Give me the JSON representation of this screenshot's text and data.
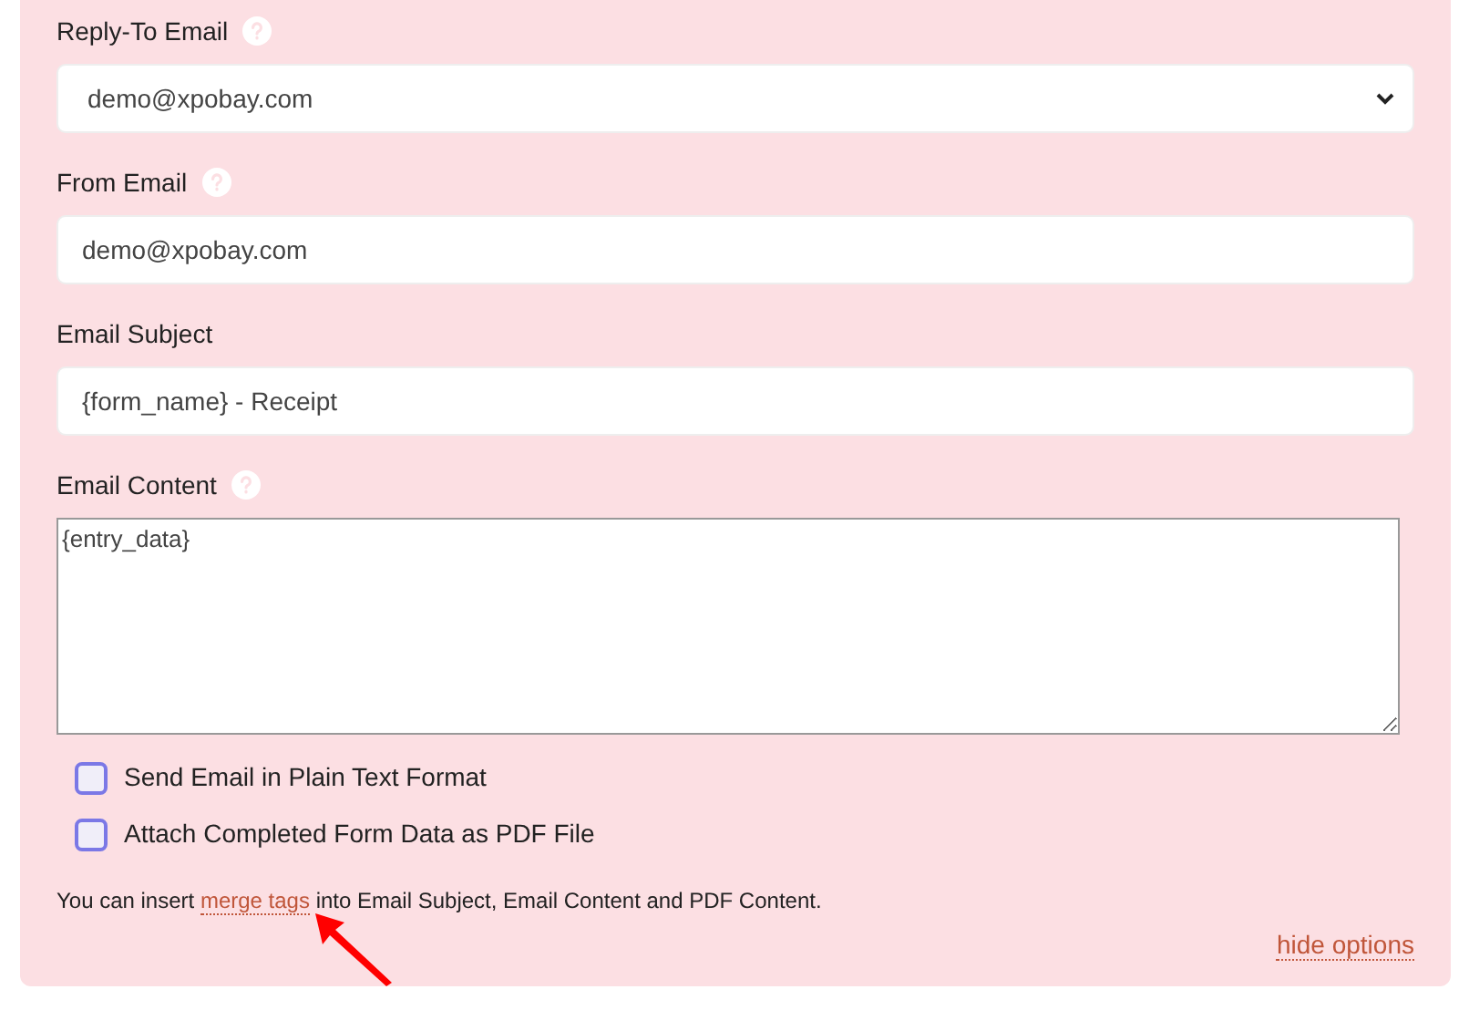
{
  "fields": [
    {
      "kind": "select",
      "label": "Reply-To Email",
      "help": true,
      "value": "demo@xpobay.com"
    },
    {
      "kind": "input",
      "label": "From Email",
      "help": true,
      "value": "demo@xpobay.com"
    },
    {
      "kind": "input",
      "label": "Email Subject",
      "help": false,
      "value": "{form_name} - Receipt"
    },
    {
      "kind": "textarea",
      "label": "Email Content",
      "help": true,
      "value": "{entry_data}"
    }
  ],
  "checkboxes": [
    {
      "label": "Send Email in Plain Text Format",
      "checked": false
    },
    {
      "label": "Attach Completed Form Data as PDF File",
      "checked": false
    }
  ],
  "note": {
    "before": "You can insert",
    "link": "merge tags",
    "after": "into Email Subject, Email Content and PDF Content."
  },
  "hide_link": "hide options"
}
